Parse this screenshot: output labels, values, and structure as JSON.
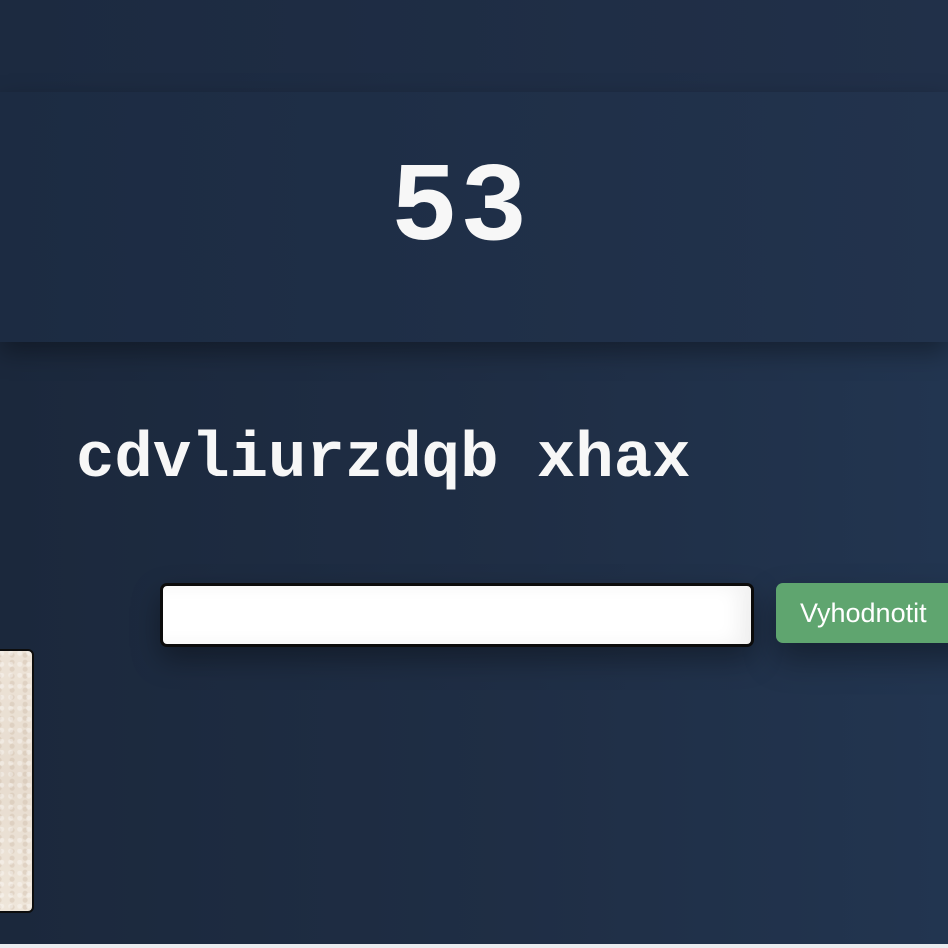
{
  "score": {
    "value": "53"
  },
  "word": {
    "text": "cdvliurzdqb xhax"
  },
  "answer": {
    "value": "",
    "placeholder": ""
  },
  "actions": {
    "evaluate_label": "Vyhodnotit"
  },
  "colors": {
    "background": "#1f2e45",
    "text": "#f7f7f7",
    "button": "#5fa56f",
    "input_border": "#0c0c0c"
  }
}
